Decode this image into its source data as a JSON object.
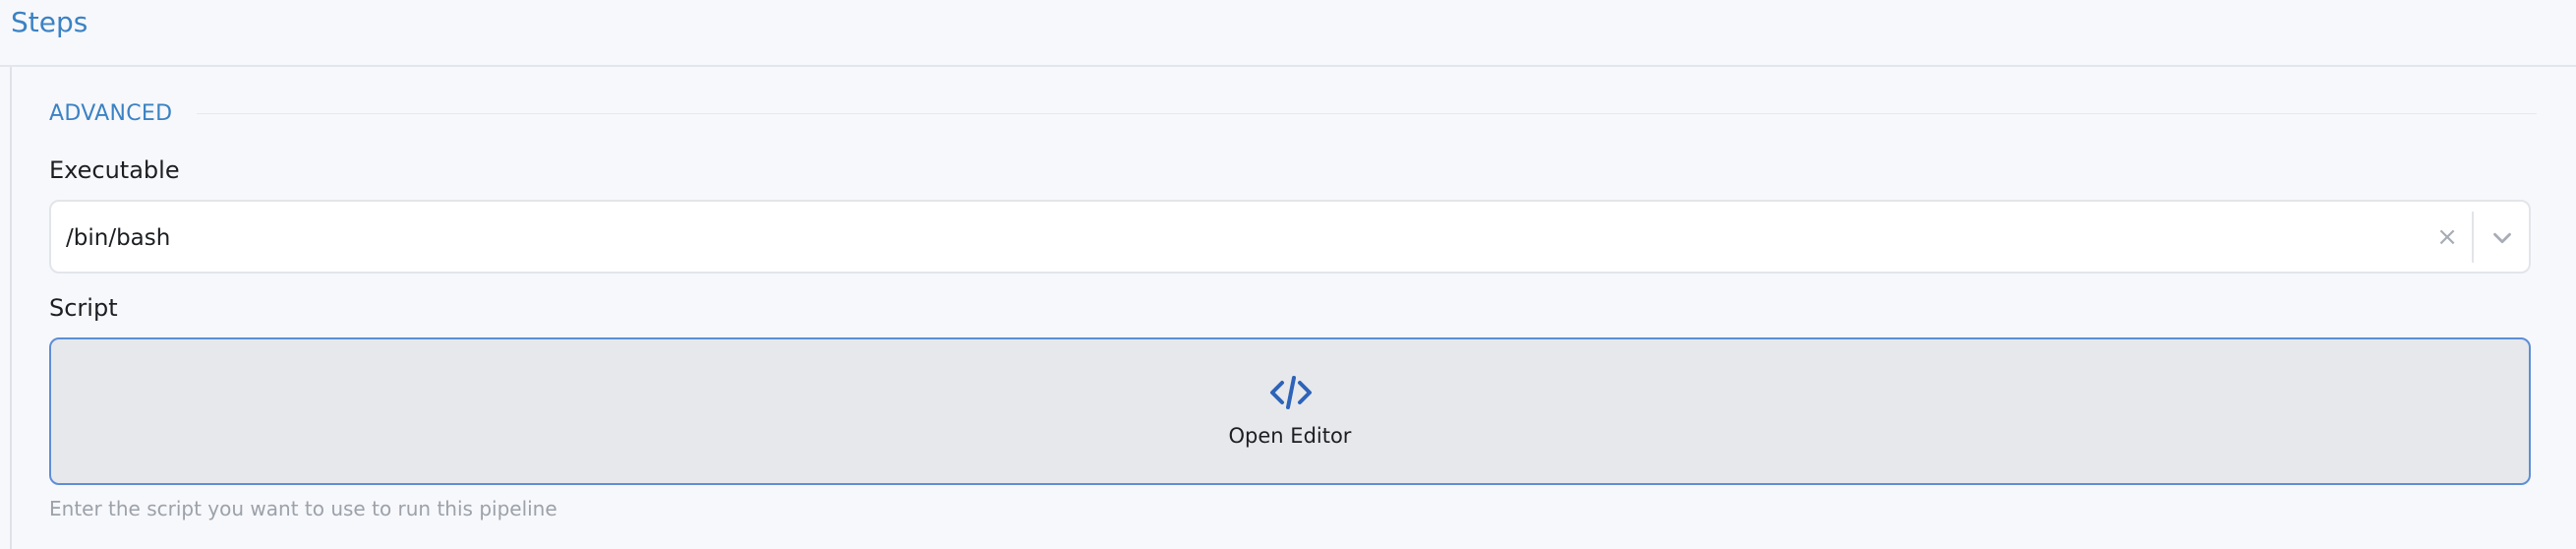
{
  "header": {
    "title": "Steps"
  },
  "section": {
    "legend": "ADVANCED"
  },
  "executable": {
    "label": "Executable",
    "value": "/bin/bash",
    "clear_icon": "close-icon",
    "dropdown_icon": "chevron-down-icon"
  },
  "script": {
    "label": "Script",
    "button_icon": "code-icon",
    "button_label": "Open Editor",
    "help_text": "Enter the script you want to use to run this pipeline"
  },
  "colors": {
    "accent": "#3b82c4",
    "editor_border": "#5d8ed6",
    "editor_background": "#e7e8eb",
    "page_background": "#f7f8fb",
    "help_text": "#9ca1aa"
  }
}
